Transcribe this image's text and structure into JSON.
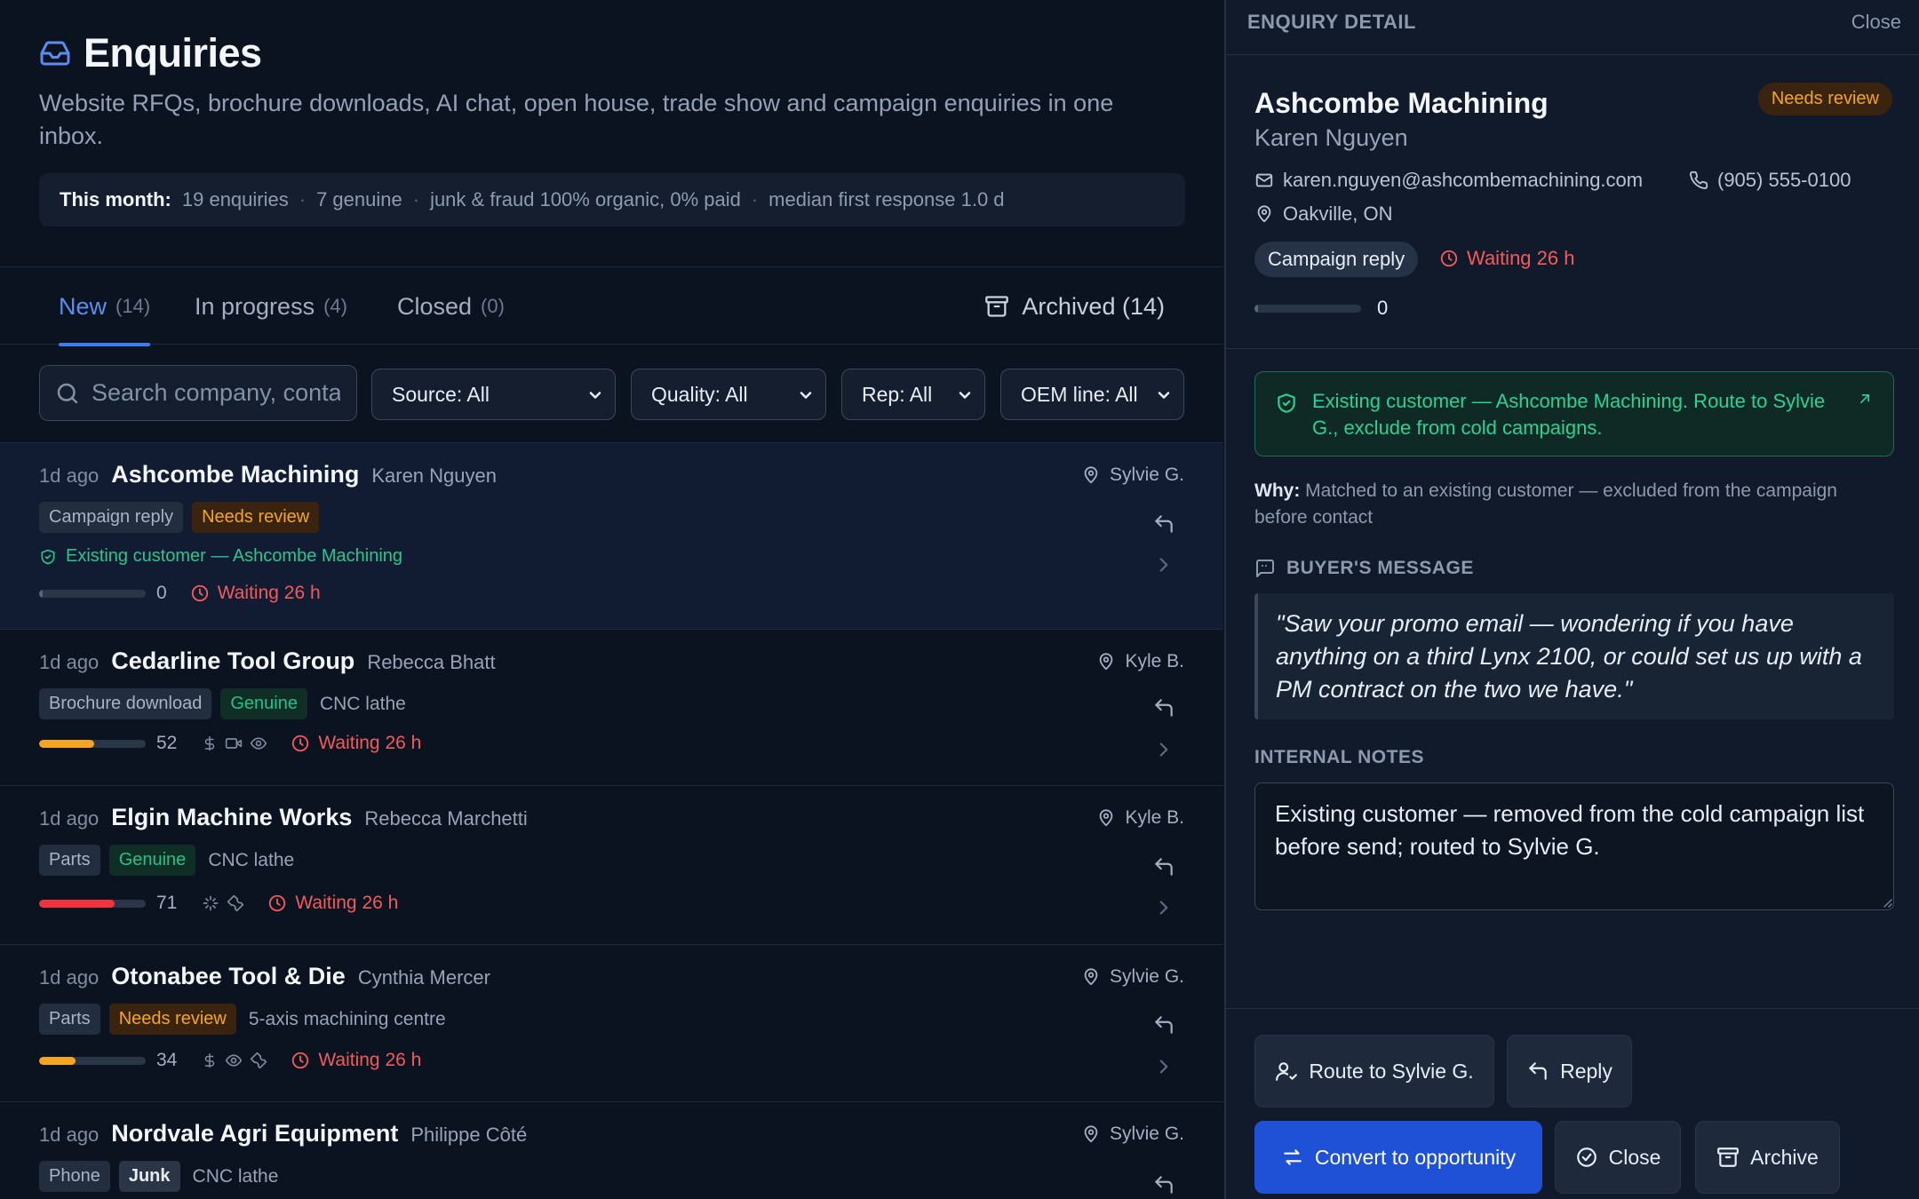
{
  "page": {
    "title": "Enquiries",
    "subtitle": "Website RFQs, brochure downloads, AI chat, open house, trade show and campaign enquiries in one inbox.",
    "stats": {
      "label": "This month:",
      "enquiries": "19 enquiries",
      "genuine": "7 genuine",
      "junk": "junk & fraud 100% organic, 0% paid",
      "response": "median first response 1.0 d",
      "sep": "·"
    }
  },
  "tabs": [
    {
      "label": "New",
      "count": "(14)"
    },
    {
      "label": "In progress",
      "count": "(4)"
    },
    {
      "label": "Closed",
      "count": "(0)"
    }
  ],
  "archived_tab": "Archived (14)",
  "filters": {
    "search_placeholder": "Search company, contact",
    "source": "Source: All",
    "quality": "Quality: All",
    "rep": "Rep: All",
    "oem": "OEM line: All"
  },
  "list": [
    {
      "ago": "1d ago",
      "company": "Ashcombe Machining",
      "contact": "Karen Nguyen",
      "rep": "Sylvie G.",
      "source": "Campaign reply",
      "quality": "Needs review",
      "oem": "",
      "existing": "Existing customer — Ashcombe Machining",
      "score": "0",
      "score_fraction": 0.0,
      "waiting": "Waiting 26 h"
    },
    {
      "ago": "1d ago",
      "company": "Cedarline Tool Group",
      "contact": "Rebecca Bhatt",
      "rep": "Kyle B.",
      "source": "Brochure download",
      "quality": "Genuine",
      "oem": "CNC lathe",
      "score": "52",
      "score_fraction": 0.52,
      "waiting": "Waiting 26 h"
    },
    {
      "ago": "1d ago",
      "company": "Elgin Machine Works",
      "contact": "Rebecca Marchetti",
      "rep": "Kyle B.",
      "source": "Parts",
      "quality": "Genuine",
      "oem": "CNC lathe",
      "score": "71",
      "score_fraction": 0.71,
      "waiting": "Waiting 26 h"
    },
    {
      "ago": "1d ago",
      "company": "Otonabee Tool & Die",
      "contact": "Cynthia Mercer",
      "rep": "Sylvie G.",
      "source": "Parts",
      "quality": "Needs review",
      "oem": "5-axis machining centre",
      "score": "34",
      "score_fraction": 0.34,
      "waiting": "Waiting 26 h"
    },
    {
      "ago": "1d ago",
      "company": "Nordvale Agri Equipment",
      "contact": "Philippe Côté",
      "rep": "Sylvie G.",
      "source": "Phone",
      "quality": "Junk",
      "oem": "CNC lathe"
    }
  ],
  "detail": {
    "header": "ENQUIRY DETAIL",
    "close": "Close",
    "company": "Ashcombe Machining",
    "contact": "Karen Nguyen",
    "badge": "Needs review",
    "email": "karen.nguyen@ashcombemachining.com",
    "phone": "(905) 555-0100",
    "location": "Oakville, ON",
    "source": "Campaign reply",
    "waiting": "Waiting 26 h",
    "score": "0",
    "alert": "Existing customer — Ashcombe Machining. Route to Sylvie G., exclude from cold campaigns.",
    "why_label": "Why:",
    "why": "Matched to an existing customer — excluded from the campaign before contact",
    "message_heading": "BUYER'S MESSAGE",
    "message": "\"Saw your promo email — wondering if you have anything on a third Lynx 2100, or could set us up with a PM contract on the two we have.\"",
    "notes_heading": "INTERNAL NOTES",
    "notes": "Existing customer — removed from the cold campaign list before send; routed to Sylvie G.",
    "actions": {
      "route": "Route to Sylvie G.",
      "reply": "Reply",
      "convert": "Convert to opportunity",
      "close": "Close",
      "archive": "Archive"
    }
  },
  "colors": {
    "accent": "#3d7bf0",
    "danger": "#f25b5b",
    "warning": "#f5a524",
    "success": "#27c08a",
    "score_mid": "#f5a524",
    "score_high": "#ef3340"
  }
}
